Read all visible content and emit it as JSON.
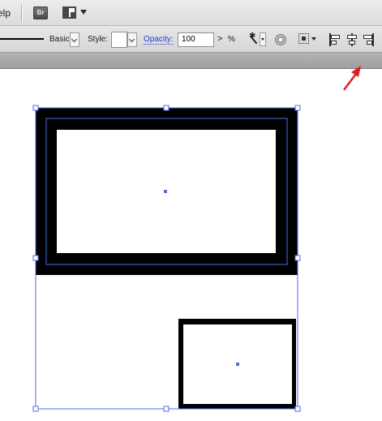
{
  "menubar": {
    "help_label": "elp",
    "bridge_label": "Br",
    "icons": [
      "bridge-icon",
      "arrange-documents-icon",
      "dropdown-arrow-icon"
    ]
  },
  "control": {
    "stroke_profile": "Basic",
    "style_label": "Style:",
    "opacity_label": "Opacity:",
    "opacity_value": "100",
    "opacity_arrow": ">",
    "percent": "%",
    "icons": [
      "recolor-artwork-icon",
      "graphic-style-icon",
      "isolate-group-icon",
      "align-left-icon",
      "align-horizontal-center-icon",
      "align-right-icon"
    ]
  },
  "colors": {
    "selection": "#3f5fd9",
    "annotation_arrow": "#e0201e",
    "toolbar_bg": "#e0e0e0",
    "strip_bg": "#a8a8a8"
  }
}
